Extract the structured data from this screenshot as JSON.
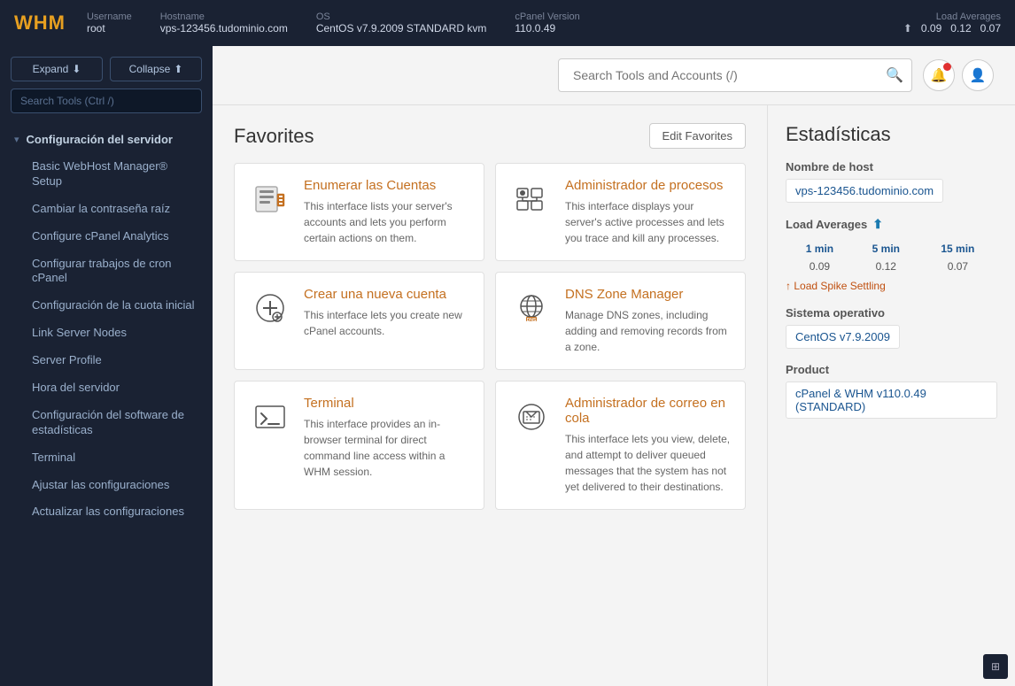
{
  "topbar": {
    "logo": "WHM",
    "username_label": "Username",
    "username": "root",
    "hostname_label": "Hostname",
    "hostname": "vps-123456.tudominio.com",
    "os_label": "OS",
    "os": "CentOS v7.9.2009 STANDARD kvm",
    "cpanel_label": "cPanel Version",
    "cpanel": "110.0.49",
    "load_label": "Load Averages",
    "load_1": "0.09",
    "load_5": "0.12",
    "load_15": "0.07"
  },
  "sidebar": {
    "expand_label": "Expand",
    "collapse_label": "Collapse",
    "search_placeholder": "Search Tools (Ctrl /)",
    "section": "Configuración del servidor",
    "nav_items": [
      "Basic WebHost Manager® Setup",
      "Cambiar la contraseña raíz",
      "Configure cPanel Analytics",
      "Configurar trabajos de cron cPanel",
      "Configuración de la cuota inicial",
      "Link Server Nodes",
      "Server Profile",
      "Hora del servidor",
      "Configuración del software de estadísticas",
      "Terminal",
      "Ajustar las configuraciones",
      "Actualizar las configuraciones"
    ]
  },
  "header": {
    "search_placeholder": "Search Tools and Accounts (/)"
  },
  "favorites": {
    "title": "Favorites",
    "edit_button": "Edit Favorites",
    "cards": [
      {
        "title": "Enumerar las Cuentas",
        "desc": "This interface lists your server's accounts and lets you perform certain actions on them."
      },
      {
        "title": "Administrador de procesos",
        "desc": "This interface displays your server's active processes and lets you trace and kill any processes."
      },
      {
        "title": "Crear una nueva cuenta",
        "desc": "This interface lets you create new cPanel accounts."
      },
      {
        "title": "DNS Zone Manager",
        "desc": "Manage DNS zones, including adding and removing records from a zone."
      },
      {
        "title": "Terminal",
        "desc": "This interface provides an in-browser terminal for direct command line access within a WHM session."
      },
      {
        "title": "Administrador de correo en cola",
        "desc": "This interface lets you view, delete, and attempt to deliver queued messages that the system has not yet delivered to their destinations."
      }
    ]
  },
  "stats": {
    "title": "Estadísticas",
    "hostname_label": "Nombre de host",
    "hostname_value": "vps-123456.tudominio.com",
    "load_label": "Load Averages",
    "load_1min": "1 min",
    "load_5min": "5 min",
    "load_15min": "15 min",
    "load_1": "0.09",
    "load_5": "0.12",
    "load_15": "0.07",
    "load_spike": "Load Spike Settling",
    "os_label": "Sistema operativo",
    "os_value": "CentOS v7.9.2009",
    "product_label": "Product",
    "product_value": "cPanel & WHM v110.0.49 (STANDARD)"
  }
}
